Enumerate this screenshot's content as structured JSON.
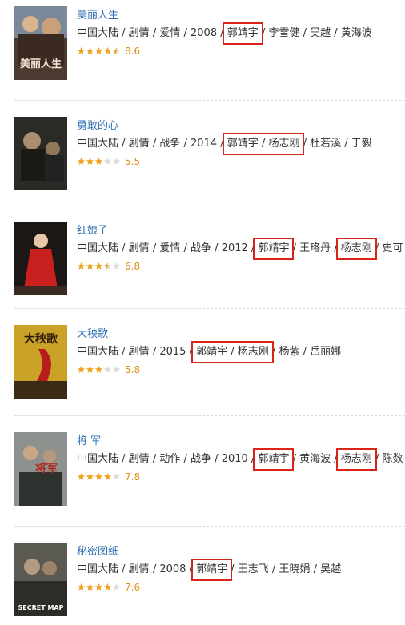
{
  "items": [
    {
      "title": "美丽人生",
      "meta": "中国大陆 / 剧情 / 爱情 / 2008 / 郭靖宇 / 李雪健 / 吴越 / 黄海波",
      "stars": 4.5,
      "score": "8.6",
      "poster": {
        "bg": "#4a3a30",
        "accent": "#e8c9a0",
        "text": "美丽人生",
        "text_color": "#f2e6d0"
      }
    },
    {
      "title": "勇敢的心",
      "meta": "中国大陆 / 剧情 / 战争 / 2014 / 郭靖宇 / 杨志刚 / 杜若溪 / 于毅",
      "stars": 3,
      "score": "5.5",
      "poster": {
        "bg": "#2b2a26",
        "accent": "#8a7a58",
        "text": "",
        "text_color": "#cbb98a"
      }
    },
    {
      "title": "红娘子",
      "meta": "中国大陆 / 剧情 / 爱情 / 战争 / 2012 / 郭靖宇 / 王珞丹 / 杨志刚 / 史可",
      "stars": 3.5,
      "score": "6.8",
      "poster": {
        "bg": "#1c1614",
        "accent": "#c8201e",
        "text": "",
        "text_color": "#d8c9a8"
      }
    },
    {
      "title": "大秧歌",
      "meta": "中国大陆 / 剧情 / 2015 / 郭靖宇 / 杨志刚 / 杨紫 / 岳丽娜",
      "stars": 3,
      "score": "5.8",
      "poster": {
        "bg": "#c9a227",
        "accent": "#b81c1c",
        "text": "大秧歌",
        "text_color": "#2a1a0c"
      }
    },
    {
      "title": "将 军",
      "meta": "中国大陆 / 剧情 / 动作 / 战争 / 2010 / 郭靖宇 / 黄海波 / 杨志刚 / 陈数",
      "stars": 4,
      "score": "7.8",
      "poster": {
        "bg": "#6b6f6c",
        "accent": "#b3261e",
        "text": "将军",
        "text_color": "#b3261e"
      }
    },
    {
      "title": "秘密图纸",
      "meta": "中国大陆 / 剧情 / 2008 / 郭靖宇 / 王志飞 / 王晓娟 / 吴越",
      "stars": 4,
      "score": "7.6",
      "poster": {
        "bg": "#5a5a52",
        "accent": "#c02a20",
        "text": "SECRET MAP",
        "text_color": "#ffffff"
      }
    }
  ],
  "highlight_color": "#d9241a",
  "star_color": "#f0a21c",
  "title_color": "#2f6fb3"
}
